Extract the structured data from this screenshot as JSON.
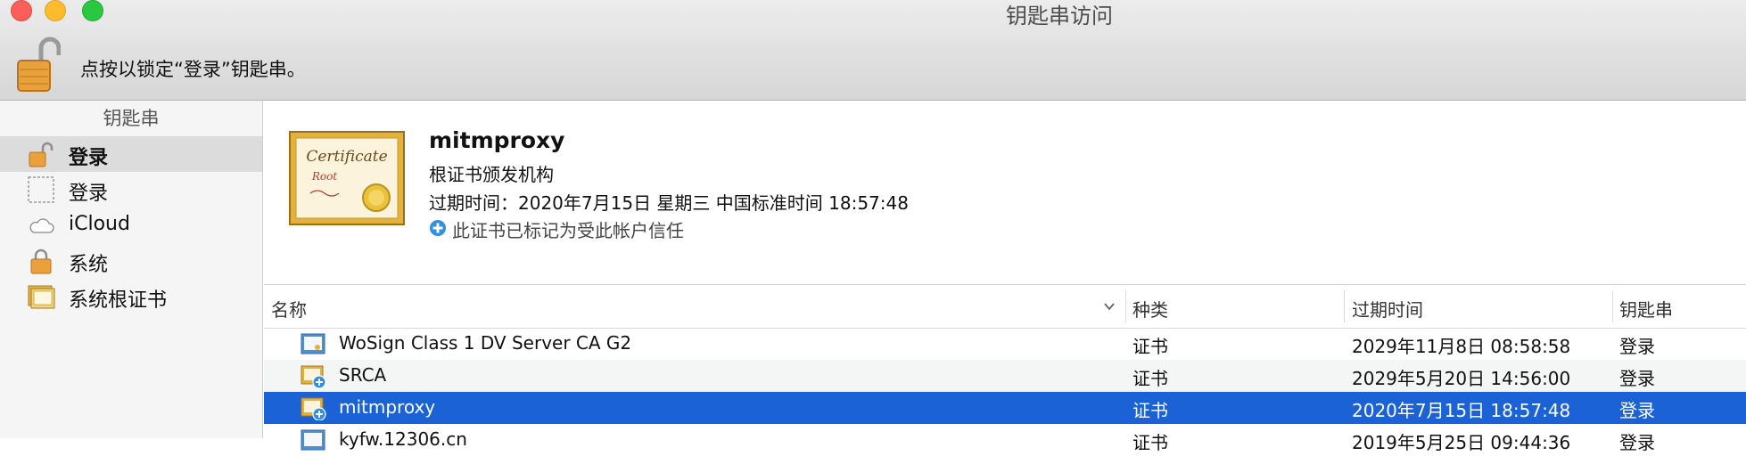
{
  "window": {
    "title": "钥匙串访问",
    "lock_text": "点按以锁定“登录”钥匙串。"
  },
  "sidebar": {
    "heading": "钥匙串",
    "items": [
      {
        "label": "登录",
        "icon": "unlocked-padlock-icon",
        "selected": true
      },
      {
        "label": "登录",
        "icon": "dashed-keychain-icon",
        "selected": false
      },
      {
        "label": "iCloud",
        "icon": "cloud-icon",
        "selected": false
      },
      {
        "label": "系统",
        "icon": "padlock-icon",
        "selected": false
      },
      {
        "label": "系统根证书",
        "icon": "certificate-folder-icon",
        "selected": false
      }
    ]
  },
  "detail": {
    "cert_image_text": [
      "Certificate",
      "Root"
    ],
    "name": "mitmproxy",
    "type": "根证书颁发机构",
    "expiry": "过期时间：2020年7月15日 星期三 中国标准时间 18:57:48",
    "trust": "此证书已标记为受此帐户信任"
  },
  "table": {
    "columns": [
      "名称",
      "种类",
      "过期时间",
      "钥匙串"
    ],
    "rows": [
      {
        "name": "WoSign Class 1 DV Server CA G2",
        "kind": "证书",
        "expires": "2029年11月8日 08:58:58",
        "keychain": "登录",
        "icon": "certificate-icon"
      },
      {
        "name": "SRCA",
        "kind": "证书",
        "expires": "2029年5月20日 14:56:00",
        "keychain": "登录",
        "icon": "trusted-certificate-icon"
      },
      {
        "name": "mitmproxy",
        "kind": "证书",
        "expires": "2020年7月15日 18:57:48",
        "keychain": "登录",
        "icon": "trusted-certificate-icon",
        "selected": true
      },
      {
        "name": "kyfw.12306.cn",
        "kind": "证书",
        "expires": "2019年5月25日 09:44:36",
        "keychain": "登录",
        "icon": "certificate-icon"
      }
    ]
  },
  "colors": {
    "selection": "#1a62d6",
    "trust_blue": "#2f8fe0",
    "cert_gold": "#e2b23d"
  }
}
